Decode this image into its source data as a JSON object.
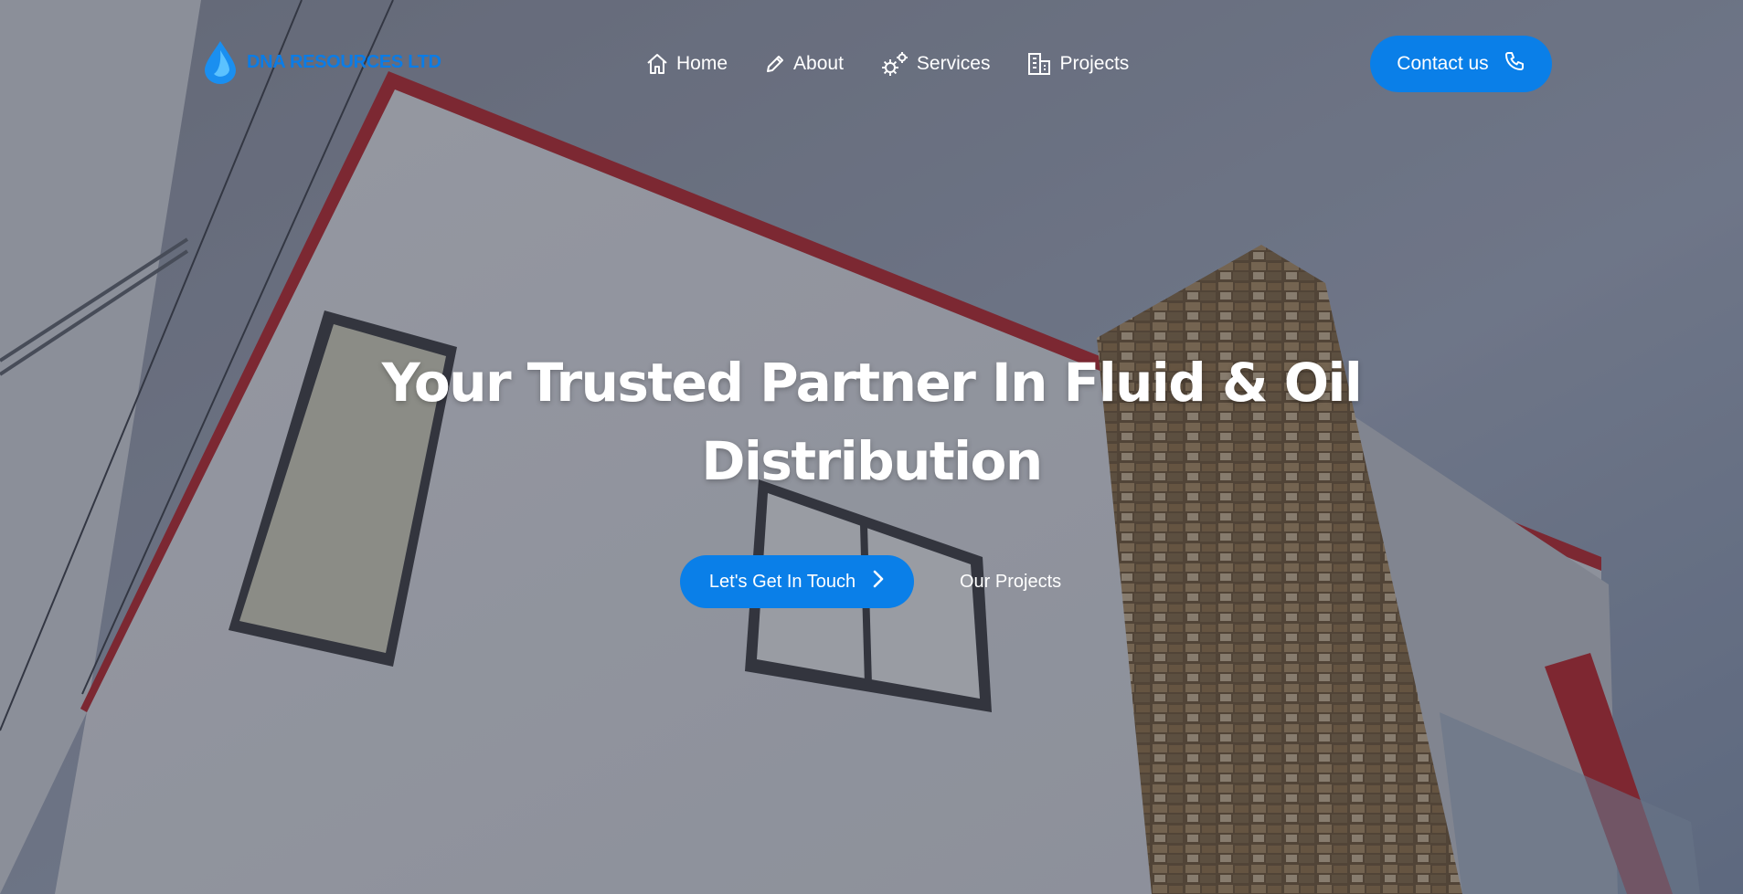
{
  "brand": {
    "name": "DNA RESOURCES LTD",
    "logo_icon": "droplet-icon",
    "color": "#0b7ce6"
  },
  "nav": {
    "items": [
      {
        "label": "Home",
        "icon": "home-icon"
      },
      {
        "label": "About",
        "icon": "pencil-icon"
      },
      {
        "label": "Services",
        "icon": "gears-icon"
      },
      {
        "label": "Projects",
        "icon": "building-icon"
      }
    ],
    "contact": {
      "label": "Contact us",
      "icon": "phone-icon"
    }
  },
  "hero": {
    "title": "Your Trusted Partner In Fluid & Oil Distribution",
    "primary_cta": {
      "label": "Let's Get In Touch",
      "icon": "chevron-right-icon"
    },
    "secondary_cta": {
      "label": "Our Projects"
    }
  },
  "colors": {
    "accent": "#0a7fe8",
    "text": "#ffffff"
  }
}
